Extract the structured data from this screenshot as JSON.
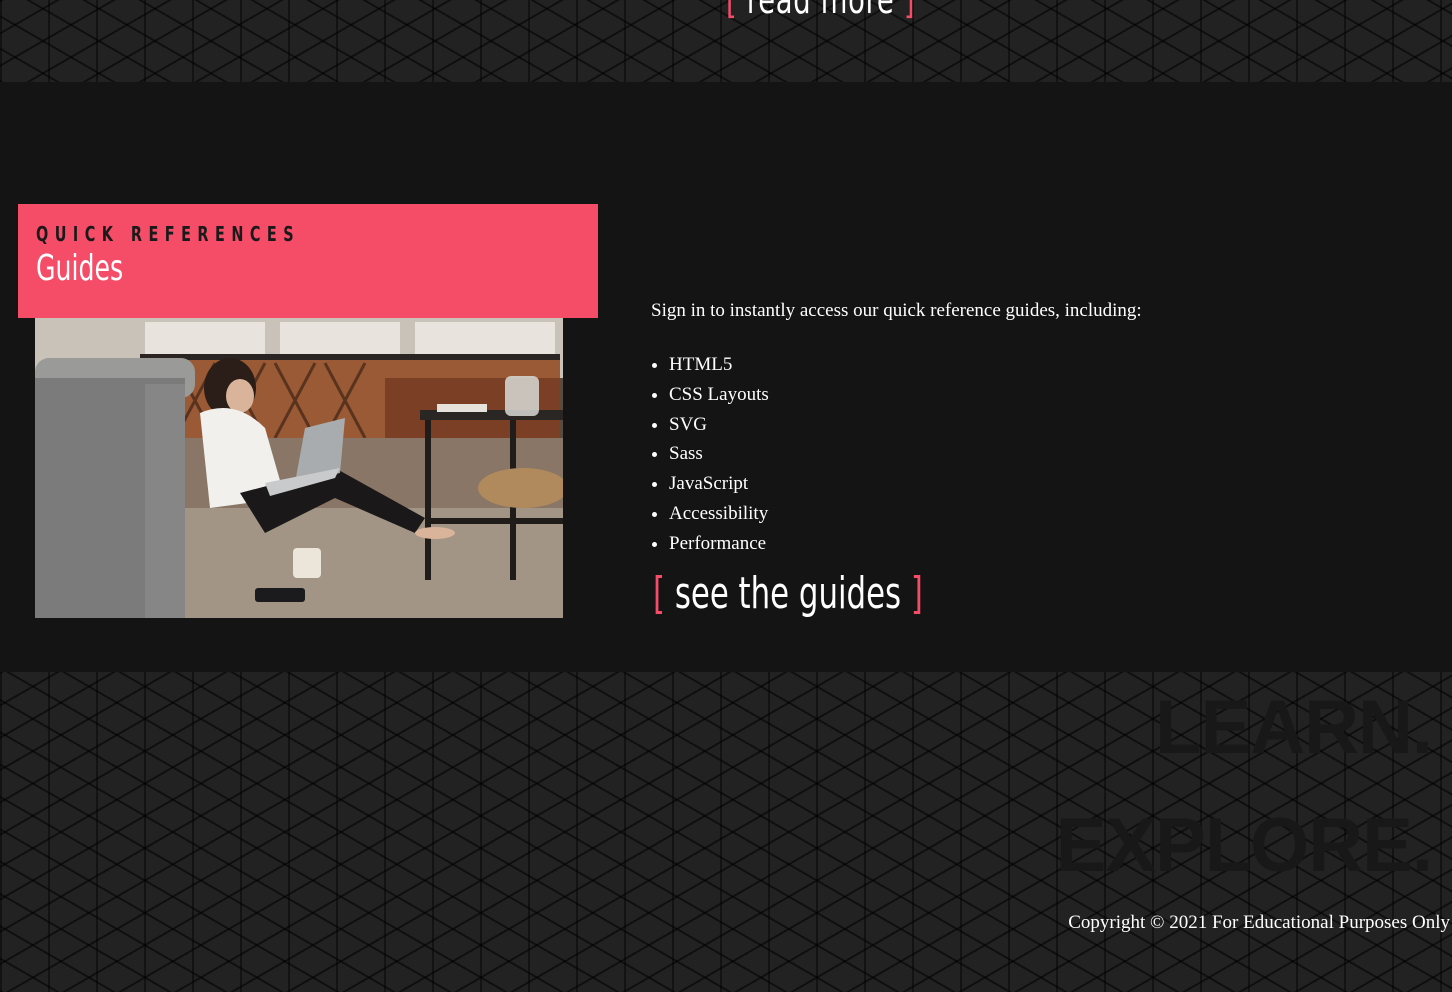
{
  "top_band": {
    "link_label": "read more",
    "bracket_open": "[",
    "bracket_close": "]"
  },
  "guides": {
    "eyebrow": "QUICK REFERENCES",
    "title": "Guides",
    "image_alt": "Woman sitting on the floor working on a laptop",
    "intro": "Sign in to instantly access our quick reference guides, including:",
    "topics": [
      "HTML5",
      "CSS Layouts",
      "SVG",
      "Sass",
      "JavaScript",
      "Accessibility",
      "Performance"
    ],
    "cta_label": "see the guides",
    "cta_bracket_open": "[",
    "cta_bracket_close": "]"
  },
  "footer": {
    "tagline": [
      "LEARN.",
      "EXPLORE."
    ],
    "copyright": "Copyright © 2021 For Educational Purposes Only"
  },
  "colors": {
    "accent": "#f54c68",
    "section_background": "#141414",
    "pattern_background": "#222222",
    "text": "#ffffff"
  }
}
